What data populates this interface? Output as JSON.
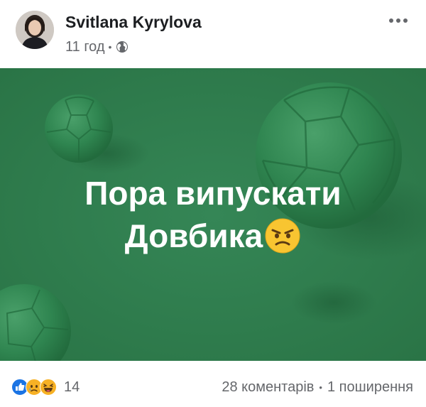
{
  "post": {
    "author": "Svitlana Kyrylova",
    "time": "11 год",
    "privacy_icon": "globe-icon",
    "more_icon": "more-horizontal-icon",
    "image": {
      "line1": "Пора випускати",
      "line2": "Довбика",
      "emoji": "angry-face-emoji",
      "background_color": "#2f7d4d"
    },
    "reactions": {
      "icons": [
        "like-icon",
        "sad-icon",
        "haha-icon"
      ],
      "count": "14"
    },
    "comments": "28 коментарів",
    "shares": "1 поширення"
  }
}
